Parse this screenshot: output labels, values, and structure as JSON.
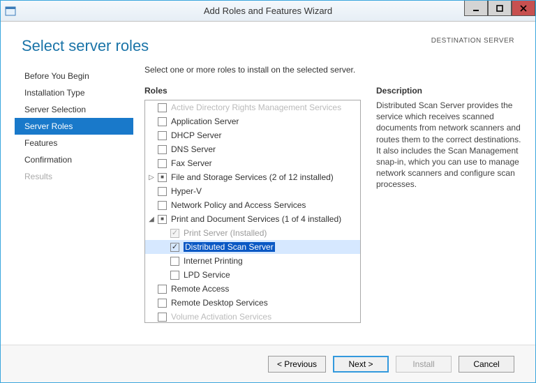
{
  "window": {
    "title": "Add Roles and Features Wizard"
  },
  "header": {
    "page_title": "Select server roles",
    "destination_label": "DESTINATION SERVER"
  },
  "nav": {
    "items": [
      {
        "label": "Before You Begin",
        "state": "normal"
      },
      {
        "label": "Installation Type",
        "state": "normal"
      },
      {
        "label": "Server Selection",
        "state": "normal"
      },
      {
        "label": "Server Roles",
        "state": "selected"
      },
      {
        "label": "Features",
        "state": "normal"
      },
      {
        "label": "Confirmation",
        "state": "normal"
      },
      {
        "label": "Results",
        "state": "disabled"
      }
    ]
  },
  "main": {
    "instruction": "Select one or more roles to install on the selected server.",
    "roles_heading": "Roles",
    "description_heading": "Description",
    "description_text": "Distributed Scan Server provides the service which receives scanned documents from network scanners and routes them to the correct destinations. It also includes the Scan Management snap-in, which you can use to manage network scanners and configure scan processes."
  },
  "roles": [
    {
      "label": "Active Directory Rights Management Services",
      "indent": 0,
      "check": "empty",
      "cutoff": true
    },
    {
      "label": "Application Server",
      "indent": 0,
      "check": "empty"
    },
    {
      "label": "DHCP Server",
      "indent": 0,
      "check": "empty"
    },
    {
      "label": "DNS Server",
      "indent": 0,
      "check": "empty"
    },
    {
      "label": "Fax Server",
      "indent": 0,
      "check": "empty"
    },
    {
      "label": "File and Storage Services (2 of 12 installed)",
      "indent": 0,
      "check": "partial",
      "expander": "closed"
    },
    {
      "label": "Hyper-V",
      "indent": 0,
      "check": "empty"
    },
    {
      "label": "Network Policy and Access Services",
      "indent": 0,
      "check": "empty"
    },
    {
      "label": "Print and Document Services (1 of 4 installed)",
      "indent": 0,
      "check": "partial",
      "expander": "open"
    },
    {
      "label": "Print Server (Installed)",
      "indent": 1,
      "check": "checked",
      "disabled": true
    },
    {
      "label": "Distributed Scan Server",
      "indent": 1,
      "check": "checked",
      "selected": true
    },
    {
      "label": "Internet Printing",
      "indent": 1,
      "check": "empty"
    },
    {
      "label": "LPD Service",
      "indent": 1,
      "check": "empty"
    },
    {
      "label": "Remote Access",
      "indent": 0,
      "check": "empty"
    },
    {
      "label": "Remote Desktop Services",
      "indent": 0,
      "check": "empty"
    },
    {
      "label": "Volume Activation Services",
      "indent": 0,
      "check": "empty",
      "cutoff": true
    }
  ],
  "footer": {
    "previous": "< Previous",
    "next": "Next >",
    "install": "Install",
    "cancel": "Cancel"
  }
}
